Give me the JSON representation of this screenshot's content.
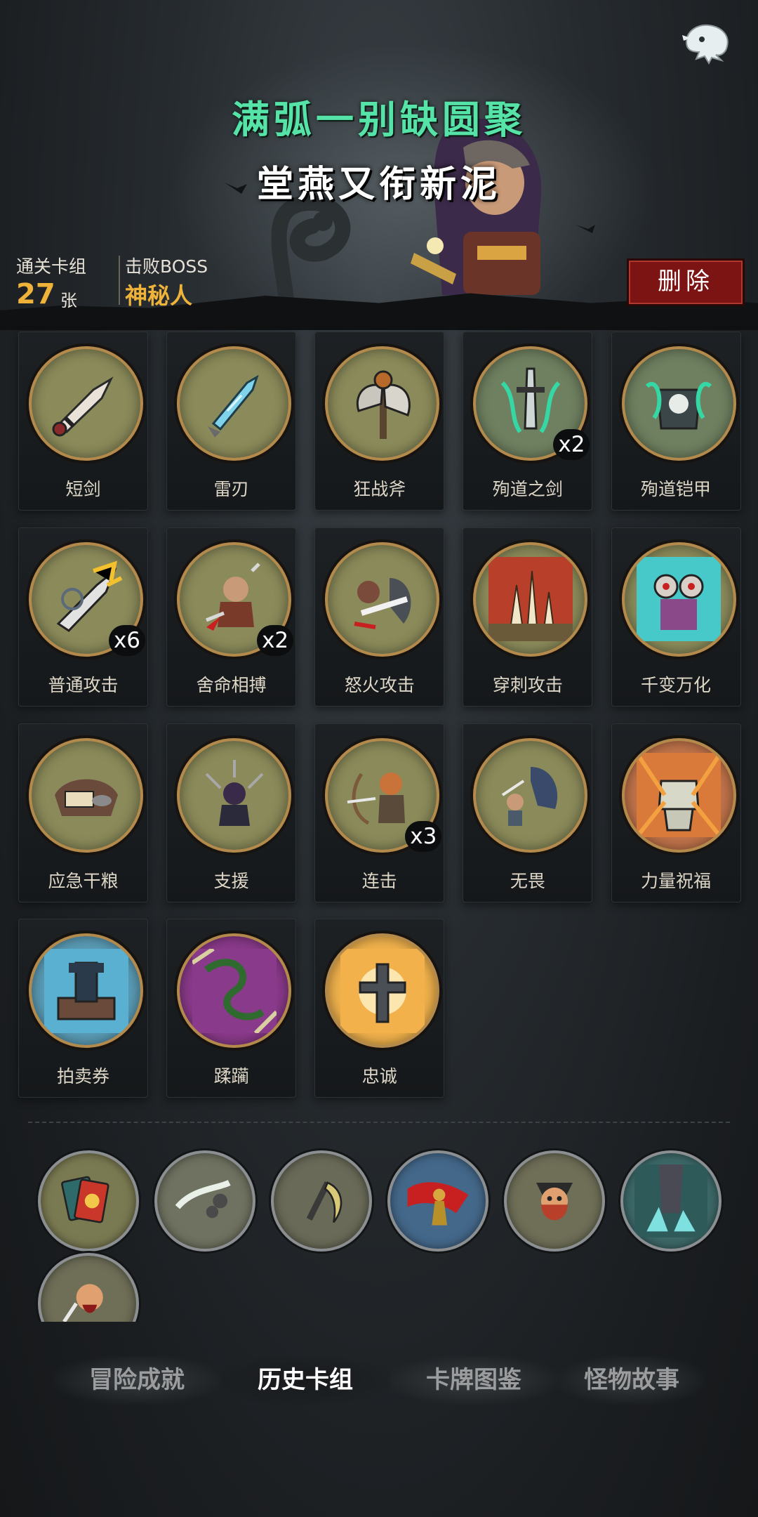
{
  "header": {
    "title_line_1": "满弧一别缺圆聚",
    "title_line_2": "堂燕又衔新泥",
    "back_icon": "ghost-back-icon"
  },
  "stats": {
    "cleared_deck_label": "通关卡组",
    "cleared_deck_count": "27",
    "cleared_deck_unit": "张",
    "defeated_boss_label": "击败BOSS",
    "defeated_boss_name": "神秘人",
    "delete_label": "删除"
  },
  "cards": [
    {
      "name": "短剑",
      "icon": "dagger-icon",
      "count": "",
      "bg": "#8a8a5a"
    },
    {
      "name": "雷刃",
      "icon": "thunder-blade-icon",
      "count": "",
      "bg": "#8a8a5a"
    },
    {
      "name": "狂战斧",
      "icon": "berserker-axe-icon",
      "count": "",
      "bg": "#8a8a5a"
    },
    {
      "name": "殉道之剑",
      "icon": "martyr-sword-icon",
      "count": "x2",
      "bg": "#6f8060"
    },
    {
      "name": "殉道铠甲",
      "icon": "martyr-armor-icon",
      "count": "",
      "bg": "#6f8060"
    },
    {
      "name": "普通攻击",
      "icon": "normal-attack-icon",
      "count": "x6",
      "bg": "#8a8a5a"
    },
    {
      "name": "舍命相搏",
      "icon": "desperate-fight-icon",
      "count": "x2",
      "bg": "#8a8a5a"
    },
    {
      "name": "怒火攻击",
      "icon": "fury-attack-icon",
      "count": "",
      "bg": "#8a8a5a"
    },
    {
      "name": "穿刺攻击",
      "icon": "pierce-attack-icon",
      "count": "",
      "bg": "#8a8a5a"
    },
    {
      "name": "千变万化",
      "icon": "shapeshift-icon",
      "count": "",
      "bg": "#8a8a5a"
    },
    {
      "name": "应急干粮",
      "icon": "emergency-ration-icon",
      "count": "",
      "bg": "#8a8a5a"
    },
    {
      "name": "支援",
      "icon": "support-icon",
      "count": "",
      "bg": "#8a8a5a"
    },
    {
      "name": "连击",
      "icon": "combo-icon",
      "count": "x3",
      "bg": "#8a8a5a"
    },
    {
      "name": "无畏",
      "icon": "fearless-icon",
      "count": "",
      "bg": "#8a8a5a"
    },
    {
      "name": "力量祝福",
      "icon": "strength-blessing-icon",
      "count": "",
      "bg": "#c0734a"
    },
    {
      "name": "拍卖券",
      "icon": "auction-ticket-icon",
      "count": "",
      "bg": "#5a9bb5"
    },
    {
      "name": "蹂躏",
      "icon": "ravage-icon",
      "count": "",
      "bg": "#8a3a8a"
    },
    {
      "name": "忠诚",
      "icon": "loyalty-icon",
      "count": "",
      "bg": "#f1b24c"
    }
  ],
  "relics": [
    {
      "icon": "tarot-cards-icon",
      "bg": "#7a7a52"
    },
    {
      "icon": "slashing-chain-icon",
      "bg": "#6f7260"
    },
    {
      "icon": "scythe-blade-icon",
      "bg": "#6a6a58"
    },
    {
      "icon": "red-cape-warrior-icon",
      "bg": "#44688a"
    },
    {
      "icon": "bearded-warrior-icon",
      "bg": "#6f6f58"
    },
    {
      "icon": "crystal-pillar-icon",
      "bg": "#3d6868"
    },
    {
      "icon": "screaming-warrior-icon",
      "bg": "#6f6f58"
    }
  ],
  "tabs": {
    "adventure": "冒险成就",
    "history": "历史卡组",
    "codex": "卡牌图鉴",
    "monster": "怪物故事",
    "active": "history"
  }
}
